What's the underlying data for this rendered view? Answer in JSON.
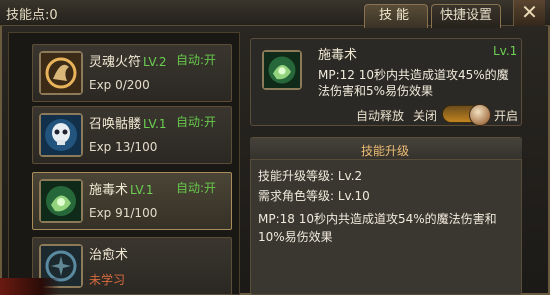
{
  "header": {
    "skill_points": "技能点:0",
    "tabs": [
      {
        "label": "技能",
        "active": true
      },
      {
        "label": "快捷设置",
        "active": false
      }
    ],
    "close_glyph": "✕"
  },
  "skills": [
    {
      "name": "灵魂火符",
      "level": "LV.2",
      "exp": "Exp 0/200",
      "auto": "自动:开",
      "icon": "fire-talisman-icon"
    },
    {
      "name": "召唤骷髅",
      "level": "LV.1",
      "exp": "Exp 13/100",
      "auto": "自动:开",
      "icon": "skull-icon"
    },
    {
      "name": "施毒术",
      "level": "LV.1",
      "exp": "Exp 91/100",
      "auto": "自动:开",
      "icon": "poison-icon",
      "selected": true
    },
    {
      "name": "治愈术",
      "status": "未学习",
      "icon": "heal-icon"
    }
  ],
  "detail": {
    "name": "施毒术",
    "level": "Lv.1",
    "description": "MP:12  10秒内共造成道攻45%的魔法伤害和5%易伤效果",
    "auto_cast_label": "自动释放",
    "off_label": "关闭",
    "on_label": "开启",
    "auto_cast_on": true
  },
  "upgrade": {
    "title": "技能升级",
    "skill_level": "技能升级等级: Lv.2",
    "role_level": "需求角色等级: Lv.10",
    "description": "MP:18  10秒内共造成道攻54%的魔法伤害和10%易伤效果"
  },
  "colors": {
    "level_green": "#6ccf52",
    "unlearned_orange": "#d86a3e",
    "gold_title": "#ecbc73"
  }
}
